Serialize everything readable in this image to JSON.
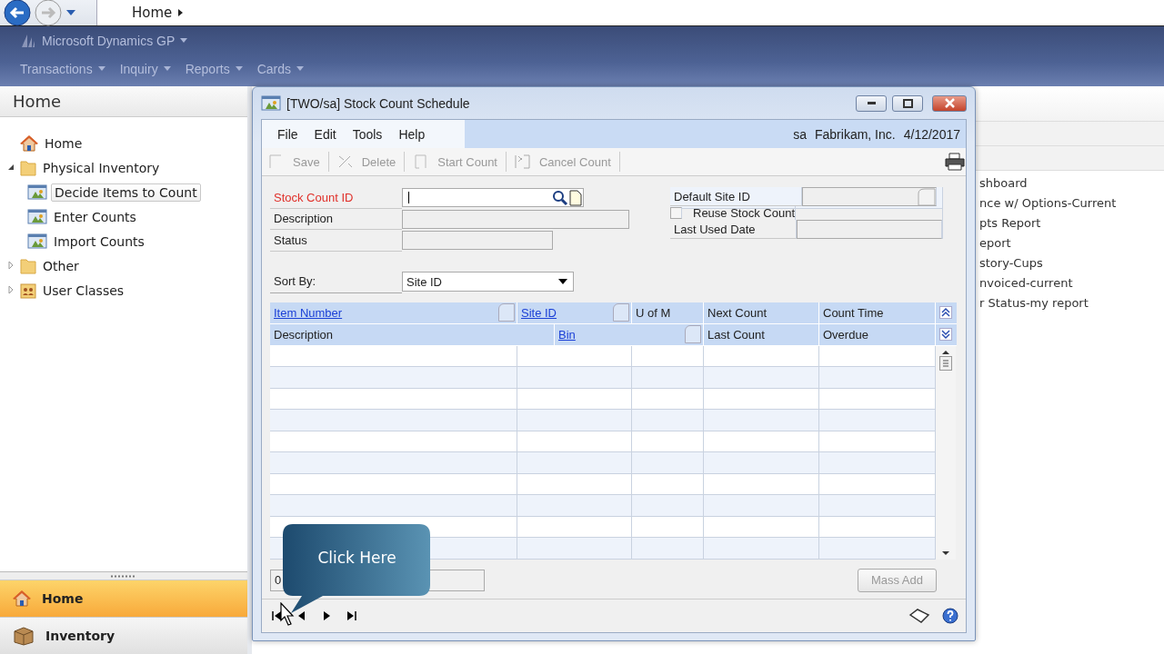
{
  "address_bar": {
    "crumb": "Home"
  },
  "ribbon": {
    "product": "Microsoft Dynamics GP",
    "menus": [
      "Transactions",
      "Inquiry",
      "Reports",
      "Cards"
    ]
  },
  "nav_pane": {
    "title": "Home",
    "tree": [
      {
        "label": "Home",
        "kind": "home"
      },
      {
        "label": "Physical Inventory",
        "kind": "folder",
        "expanded": true,
        "children": [
          {
            "label": "Decide Items to Count",
            "kind": "window",
            "selected": true
          },
          {
            "label": "Enter Counts",
            "kind": "window",
            "selected": false
          },
          {
            "label": "Import Counts",
            "kind": "window",
            "selected": false
          }
        ]
      },
      {
        "label": "Other",
        "kind": "folder",
        "expanded": false
      },
      {
        "label": "User Classes",
        "kind": "users",
        "expanded": false
      }
    ],
    "sections": [
      {
        "label": "Home",
        "kind": "home",
        "selected": true
      },
      {
        "label": "Inventory",
        "kind": "box",
        "selected": false
      }
    ]
  },
  "reports": [
    "shboard",
    "nce w/ Options-Current",
    "pts Report",
    "eport",
    "story-Cups",
    "nvoiced-current",
    "r Status-my report"
  ],
  "window": {
    "title": "[TWO/sa] Stock Count Schedule",
    "menus": [
      "File",
      "Edit",
      "Tools",
      "Help"
    ],
    "user": "sa",
    "company": "Fabrikam, Inc.",
    "date": "4/12/2017",
    "toolbar": [
      {
        "label": "Save",
        "kind": "save",
        "disabled": true
      },
      {
        "label": "Delete",
        "kind": "delete",
        "disabled": true
      },
      {
        "label": "Start Count",
        "kind": "start",
        "disabled": true
      },
      {
        "label": "Cancel Count",
        "kind": "cancel",
        "disabled": true
      }
    ],
    "left_fields": [
      {
        "label": "Stock Count ID",
        "kind": "lookup",
        "required": true,
        "disabled": false
      },
      {
        "label": "Description",
        "kind": "wide",
        "required": false,
        "disabled": true
      },
      {
        "label": "Status",
        "kind": "text",
        "required": false,
        "disabled": true
      }
    ],
    "right_fields": [
      {
        "label": "Default Site ID",
        "kind": "lookup",
        "disabled": true
      },
      {
        "label": "Reuse Stock Count",
        "kind": "checkbox",
        "checked": false,
        "disabled": false
      },
      {
        "label": "Last Used Date",
        "kind": "text",
        "disabled": true
      }
    ],
    "sort_by": {
      "label": "Sort By:",
      "value": "Site ID"
    },
    "grid": {
      "header_rows": [
        [
          {
            "label": "Item Number",
            "link": true,
            "lookup": true
          },
          {
            "label": "Site ID",
            "link": true,
            "lookup": true
          },
          {
            "label": "U of M",
            "link": false,
            "lookup": false
          },
          {
            "label": "Next Count",
            "link": false,
            "lookup": false
          },
          {
            "label": "Count Time",
            "link": false,
            "lookup": false
          }
        ],
        [
          {
            "label": "Description",
            "link": false,
            "lookup": false
          },
          {
            "label": "Bin",
            "link": true,
            "lookup": true
          },
          {
            "label": "Last Count",
            "link": false,
            "lookup": false
          },
          {
            "label": "Overdue",
            "link": false,
            "lookup": false
          }
        ]
      ]
    },
    "record_count": "0",
    "mass_add": {
      "label": "Mass Add",
      "disabled": true
    }
  },
  "callout": {
    "text": "Click Here"
  }
}
